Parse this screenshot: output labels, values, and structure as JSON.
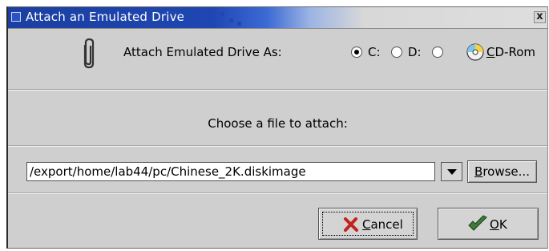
{
  "window": {
    "title": "Attach an Emulated Drive",
    "close_label": "x"
  },
  "attach_as": {
    "label": "Attach Emulated Drive As:",
    "options": [
      {
        "mnemonic": "",
        "rest": "C:",
        "selected": true
      },
      {
        "mnemonic": "",
        "rest": "D:",
        "selected": false
      },
      {
        "mnemonic": "C",
        "rest": "D-Rom",
        "selected": false
      }
    ]
  },
  "choose_label": "Choose a file to attach:",
  "file_path": "/export/home/lab44/pc/Chinese_2K.diskimage",
  "browse": {
    "mnemonic": "B",
    "rest": "rowse..."
  },
  "cancel": {
    "mnemonic": "C",
    "rest": "ancel"
  },
  "ok": {
    "mnemonic": "O",
    "rest": "K"
  },
  "colors": {
    "title_bg": "#1f47b3",
    "dialog_bg": "#cfcfcf",
    "cancel_icon": "#c0241a",
    "ok_icon": "#3f7a3a"
  },
  "icons": [
    "paperclip-icon",
    "cd-rom-icon",
    "cancel-x-icon",
    "ok-check-icon",
    "dropdown-arrow-icon",
    "close-icon"
  ]
}
